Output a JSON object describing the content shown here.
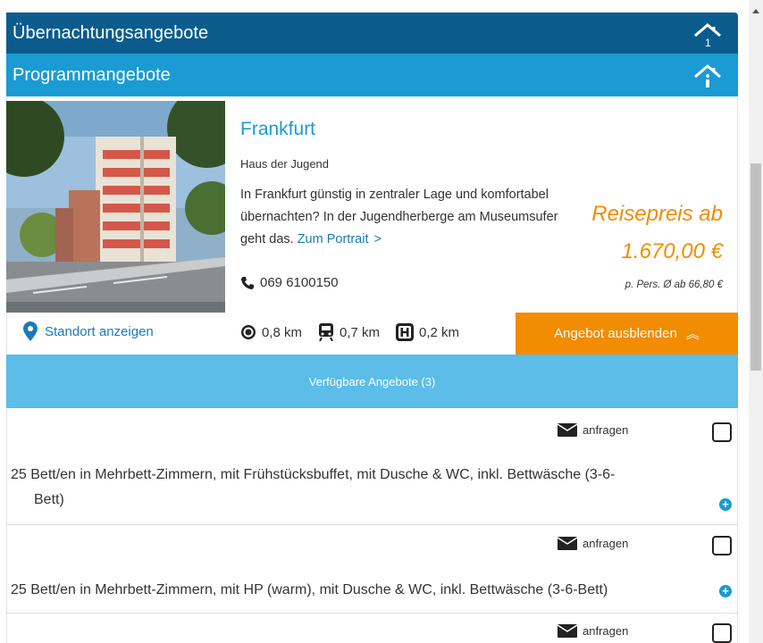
{
  "headers": {
    "accommodation": "Übernachtungsangebote",
    "program": "Programmangebote"
  },
  "hostel": {
    "city": "Frankfurt",
    "name": "Haus der Jugend",
    "description": "In Frankfurt günstig in zentraler Lage und komfortabel übernachten? In der Jugendherberge am Museumsufer geht das.",
    "portrait_link": "Zum Portrait",
    "portrait_chevron": ">",
    "phone": "069 6100150",
    "location_link": "Standort anzeigen",
    "distances": [
      {
        "icon": "target-icon",
        "value": "0,8 km"
      },
      {
        "icon": "train-icon",
        "value": "0,7 km"
      },
      {
        "icon": "bus-stop-icon",
        "value": "0,2 km"
      }
    ]
  },
  "price": {
    "label": "Reisepreis ab",
    "value": "1.670,00 €",
    "note": "p. Pers. Ø ab 66,80 €"
  },
  "buttons": {
    "hide_offer": "Angebot ausblenden",
    "hide_offer_chevron": "︽",
    "available": "Verfügbare Angebote (3)"
  },
  "offers": [
    {
      "enquire": "anfragen",
      "text_line1": "25 Bett/en in Mehrbett-Zimmern, mit Frühstücksbuffet, mit Dusche & WC, inkl. Bettwäsche (3-6-",
      "text_line2": "Bett)"
    },
    {
      "enquire": "anfragen",
      "text_line1": "25 Bett/en in Mehrbett-Zimmern, mit HP (warm), mit Dusche & WC, inkl. Bettwäsche (3-6-Bett)",
      "text_line2": ""
    },
    {
      "enquire": "anfragen",
      "text_line1": "",
      "text_line2": ""
    }
  ],
  "colors": {
    "header_dark": "#0b5c8c",
    "header_light": "#1a9bd3",
    "accent_orange": "#f28c00",
    "available_bar": "#5bbde8"
  }
}
